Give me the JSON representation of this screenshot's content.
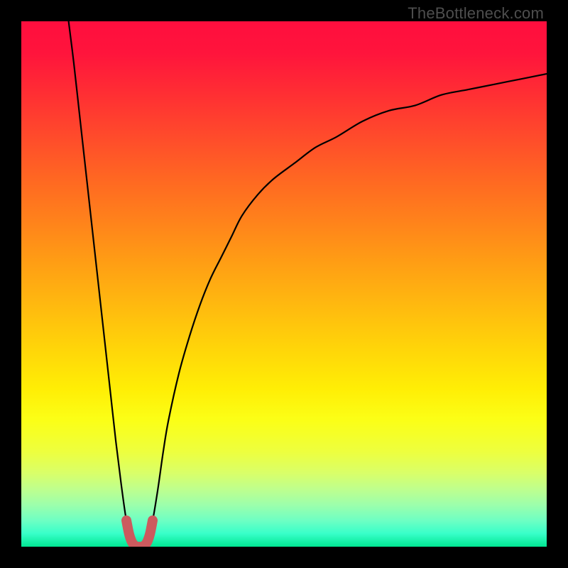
{
  "watermark": "TheBottleneck.com",
  "gradient": {
    "stops": [
      {
        "offset": 0.0,
        "color": "#ff0e3e"
      },
      {
        "offset": 0.06,
        "color": "#ff143c"
      },
      {
        "offset": 0.14,
        "color": "#ff2f33"
      },
      {
        "offset": 0.22,
        "color": "#ff4b2b"
      },
      {
        "offset": 0.3,
        "color": "#ff6722"
      },
      {
        "offset": 0.38,
        "color": "#ff821b"
      },
      {
        "offset": 0.46,
        "color": "#ff9e14"
      },
      {
        "offset": 0.54,
        "color": "#ffb90f"
      },
      {
        "offset": 0.62,
        "color": "#ffd409"
      },
      {
        "offset": 0.7,
        "color": "#ffee05"
      },
      {
        "offset": 0.76,
        "color": "#fbff17"
      },
      {
        "offset": 0.82,
        "color": "#edff3f"
      },
      {
        "offset": 0.86,
        "color": "#d9ff69"
      },
      {
        "offset": 0.89,
        "color": "#bfff8d"
      },
      {
        "offset": 0.92,
        "color": "#9dffab"
      },
      {
        "offset": 0.95,
        "color": "#6effc3"
      },
      {
        "offset": 0.975,
        "color": "#38ffc9"
      },
      {
        "offset": 1.0,
        "color": "#00e692"
      }
    ]
  },
  "chart_data": {
    "type": "line",
    "title": "",
    "xlabel": "",
    "ylabel": "",
    "xlim": [
      0,
      100
    ],
    "ylim": [
      0,
      100
    ],
    "grid": false,
    "legend_position": "none",
    "series": [
      {
        "name": "bottleneck-curve",
        "x": [
          9,
          10,
          11,
          12,
          13,
          14,
          15,
          16,
          17,
          18,
          19,
          20,
          21,
          22,
          23,
          24,
          25,
          26,
          27,
          28,
          30,
          32,
          34,
          36,
          38,
          40,
          42,
          45,
          48,
          52,
          56,
          60,
          65,
          70,
          75,
          80,
          85,
          90,
          95,
          100
        ],
        "y": [
          100,
          92,
          83,
          74,
          65,
          56,
          47,
          38,
          29,
          20,
          12,
          5,
          1,
          0,
          0,
          1,
          5,
          11,
          18,
          24,
          33,
          40,
          46,
          51,
          55,
          59,
          63,
          67,
          70,
          73,
          76,
          78,
          81,
          83,
          84,
          86,
          87,
          88,
          89,
          90
        ]
      },
      {
        "name": "minimum-marker",
        "x": [
          20.0,
          20.5,
          21.0,
          21.5,
          22.0,
          22.5,
          23.0,
          23.5,
          24.0,
          24.5,
          25.0
        ],
        "y": [
          5.0,
          2.5,
          1.0,
          0.3,
          0.0,
          0.0,
          0.0,
          0.3,
          1.0,
          2.5,
          5.0
        ]
      }
    ],
    "annotations": [],
    "colors": {
      "bottleneck-curve": "#000000",
      "minimum-marker": "#cc5a5e"
    }
  }
}
